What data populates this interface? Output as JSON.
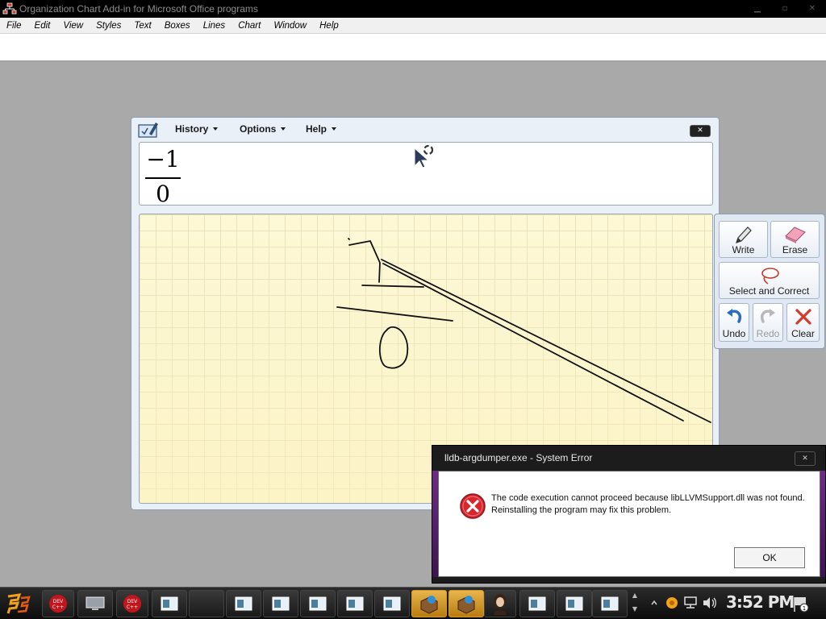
{
  "window": {
    "title": "Organization Chart Add-in for Microsoft Office programs",
    "controls": {
      "minimize": "▭",
      "restore": "▭",
      "close": "✕"
    }
  },
  "menubar": {
    "items": [
      "File",
      "Edit",
      "View",
      "Styles",
      "Text",
      "Boxes",
      "Lines",
      "Chart",
      "Window",
      "Help"
    ]
  },
  "math_panel": {
    "menus": [
      {
        "label": "History"
      },
      {
        "label": "Options"
      },
      {
        "label": "Help"
      }
    ],
    "close_glyph": "✕",
    "preview": {
      "numerator": "−1",
      "denominator": "0"
    },
    "tools": {
      "write": "Write",
      "erase": "Erase",
      "select_correct": "Select and Correct",
      "undo": "Undo",
      "redo": "Redo",
      "clear": "Clear"
    }
  },
  "error_dialog": {
    "title": "lldb-argdumper.exe - System Error",
    "close_glyph": "✕",
    "message": "The code execution cannot proceed because libLLVMSupport.dll was not found. Reinstalling the program may fix this problem.",
    "ok_label": "OK",
    "icon": "error-icon"
  },
  "taskbar": {
    "clock": "3:52 PM",
    "dev_label": "DEV C++"
  }
}
